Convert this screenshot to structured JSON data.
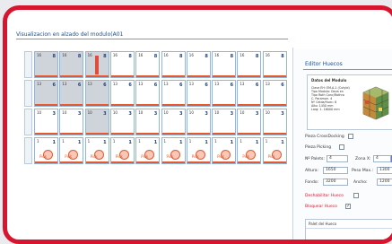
{
  "title": "Visualizacion en alzado del modulo(A01",
  "panel": {
    "title": "Editor Huecos",
    "data_box": {
      "heading": "Datos del Modulo",
      "lines": [
        "Clave EH: EM-A-1 (Cutyid)",
        "Tipo Modulo: Deva en",
        "Tipo Roth Conc/Rothro",
        "C. Paramon. 4",
        "Nº Celda/Huec: 8",
        "Alto: 1450 mm",
        "Larg: 1. 16000 mm"
      ]
    },
    "pieza_crossdocking": "Pieza CrossDocking",
    "pieza_picking": "Pieza Picking",
    "n_palets_label": "Nº Palets:",
    "n_palets_value": "4",
    "zona_label": "Zona X:",
    "zona_value": "4",
    "altura_label": "Altura:",
    "altura_value": "1650",
    "peso_label": "Peso Max.:",
    "peso_value": "1300",
    "fondo_label": "Fondo:",
    "fondo_value": "3200",
    "ancho_label": "Ancho:",
    "ancho_value": "1200",
    "deshabilitar": "Deshabilitar Hueco",
    "bloquear": "Bloquear Hueco",
    "bloquear_checked": "✓",
    "sub_title": "Palet del Hueco"
  },
  "grid": {
    "rows": [
      [
        {
          "label": "16",
          "num": "8",
          "grey": true
        },
        {
          "label": "16",
          "num": "8",
          "grey": true
        },
        {
          "label": "16",
          "num": "8",
          "grey": true,
          "blk": true
        },
        {
          "label": "16",
          "num": "8"
        },
        {
          "label": "16",
          "num": "8"
        },
        {
          "label": "16",
          "num": "8"
        },
        {
          "label": "16",
          "num": "8"
        },
        {
          "label": "16",
          "num": "8"
        },
        {
          "label": "16",
          "num": "8"
        },
        {
          "label": "16",
          "num": "8"
        }
      ],
      [
        {
          "label": "13",
          "num": "6",
          "grey": true
        },
        {
          "label": "13",
          "num": "6",
          "grey": true
        },
        {
          "label": "13",
          "num": "6",
          "grey": true
        },
        {
          "label": "13",
          "num": "6"
        },
        {
          "label": "13",
          "num": "6"
        },
        {
          "label": "13",
          "num": "6"
        },
        {
          "label": "13",
          "num": "6"
        },
        {
          "label": "13",
          "num": "6"
        },
        {
          "label": "13",
          "num": "6"
        },
        {
          "label": "13",
          "num": "6"
        }
      ],
      [
        {
          "label": "10",
          "num": "3"
        },
        {
          "label": "10",
          "num": "3"
        },
        {
          "label": "10",
          "num": "3",
          "grey": true
        },
        {
          "label": "10",
          "num": "3"
        },
        {
          "label": "10",
          "num": "3"
        },
        {
          "label": "10",
          "num": "3"
        },
        {
          "label": "10",
          "num": "3"
        },
        {
          "label": "10",
          "num": "3"
        },
        {
          "label": "10",
          "num": "3"
        },
        {
          "label": "10",
          "num": "3"
        }
      ],
      [
        {
          "label": "1",
          "num": "1",
          "pin": true,
          "tag": "Pick"
        },
        {
          "label": "1",
          "num": "1",
          "pin": true,
          "tag": "Pick"
        },
        {
          "label": "1",
          "num": "1",
          "pin": true,
          "tag": "Pick"
        },
        {
          "label": "1",
          "num": "1",
          "pin": true,
          "tag": "Pick"
        },
        {
          "label": "1",
          "num": "1",
          "pin": true,
          "tag": "Pick"
        },
        {
          "label": "1",
          "num": "1",
          "pin": true,
          "tag": "Pick"
        },
        {
          "label": "1",
          "num": "1",
          "pin": true,
          "tag": "Pick"
        },
        {
          "label": "1",
          "num": "1",
          "pin": true,
          "tag": "Pick"
        },
        {
          "label": "1",
          "num": "1",
          "pin": true,
          "tag": "Pick"
        },
        {
          "label": "1",
          "num": "1",
          "pin": true,
          "tag": "Pick"
        }
      ]
    ]
  }
}
